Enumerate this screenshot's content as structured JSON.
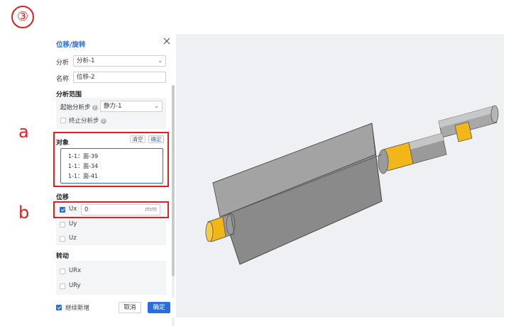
{
  "step_marker": "③",
  "callouts": {
    "a": "a",
    "b": "b"
  },
  "panel": {
    "title": "位移/旋转",
    "analysis": {
      "label": "分析",
      "value": "分析-1"
    },
    "name": {
      "label": "名称",
      "value": "位移-2"
    },
    "scope": {
      "title": "分析范围",
      "start_step": {
        "label": "起始分析步",
        "value": "静力-1"
      },
      "end_step": {
        "label": "终止分析步",
        "checked": false
      }
    },
    "object": {
      "label": "对象",
      "clear_label": "清空",
      "confirm_label": "确定",
      "items": [
        "1-1：面-39",
        "1-1：面-34",
        "1-1：面-41"
      ]
    },
    "displacement": {
      "title": "位移",
      "ux": {
        "label": "Ux",
        "checked": true,
        "value": "0",
        "unit": "mm"
      },
      "uy": {
        "label": "Uy",
        "checked": false
      },
      "uz": {
        "label": "Uz",
        "checked": false
      }
    },
    "rotation": {
      "title": "转动",
      "urx": {
        "label": "URx",
        "checked": false
      },
      "ury": {
        "label": "URy",
        "checked": false
      }
    },
    "footer": {
      "continue_label": "继续新增",
      "continue_checked": true,
      "cancel_label": "取消",
      "ok_label": "确定"
    }
  },
  "colors": {
    "accent": "#2a6de0",
    "highlight_red": "#e02020",
    "model_gray": "#7d7d7d",
    "selected_face_yellow": "#f2b619"
  }
}
